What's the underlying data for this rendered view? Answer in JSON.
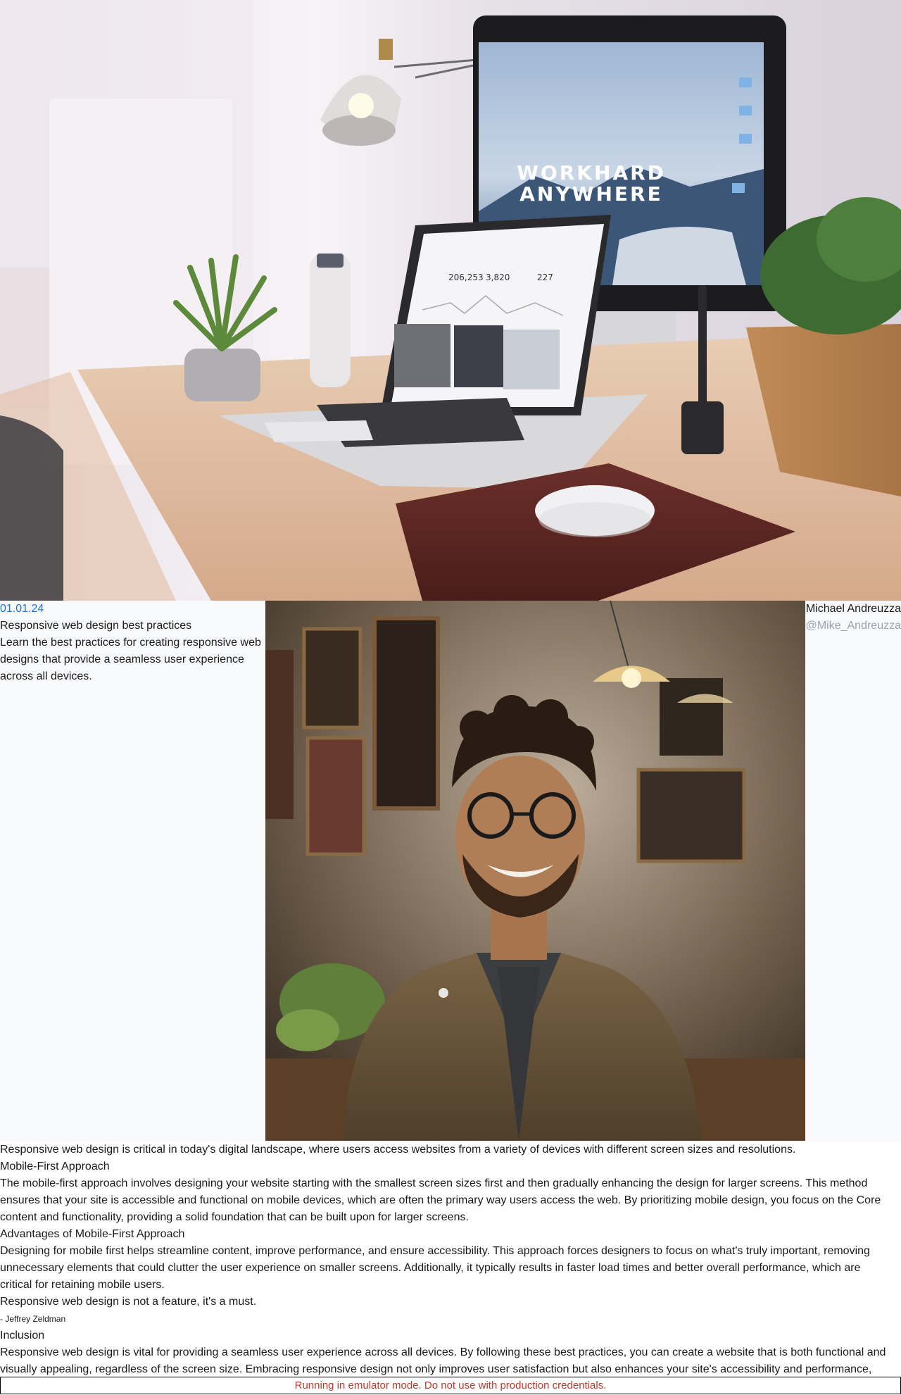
{
  "post": {
    "date": "01.01.24",
    "title": "Responsive web design best practices",
    "excerpt": "Learn the best practices for creating responsive web designs that provide a seamless user experience across all devices."
  },
  "author": {
    "name": "Michael Andreuzza",
    "handle": "@Mike_Andreuzza"
  },
  "hero": {
    "screen_headline_1": "WORKHARD",
    "screen_headline_2": "ANYWHERE",
    "laptop_stats": [
      "206,253",
      "3,820",
      "227"
    ]
  },
  "article": {
    "intro": "Responsive web design is critical in today's digital landscape, where users access websites from a variety of devices with different screen sizes and resolutions.",
    "h_mobile_first": "Mobile-First Approach",
    "p_mobile_first": "The mobile-first approach involves designing your website starting with the smallest screen sizes first and then gradually enhancing the design for larger screens. This method ensures that your site is accessible and functional on mobile devices, which are often the primary way users access the web. By prioritizing mobile design, you focus on the Core content and functionality, providing a solid foundation that can be built upon for larger screens.",
    "h_advantages": "Advantages of Mobile-First Approach",
    "p_advantages": "Designing for mobile first helps streamline content, improve performance, and ensure accessibility. This approach forces designers to focus on what's truly important, removing unnecessary elements that could clutter the user experience on smaller screens. Additionally, it typically results in faster load times and better overall performance, which are critical for retaining mobile users.",
    "quote": "Responsive web design is not a feature, it's a must.",
    "quote_author": "- Jeffrey Zeldman",
    "h_inclusion": "Inclusion",
    "p_inclusion": "Responsive web design is vital for providing a seamless user experience across all devices. By following these best practices, you can create a website that is both functional and visually appealing, regardless of the screen size. Embracing responsive design not only improves user satisfaction but also enhances your site's accessibility and performance,"
  },
  "banner": {
    "text": "Running in emulator mode. Do not use with production credentials."
  },
  "colors": {
    "date_link": "#1a73e8",
    "handle": "#9aa3b2",
    "banner_text": "#c0392b",
    "meta_bg": "#f8f9fb"
  }
}
